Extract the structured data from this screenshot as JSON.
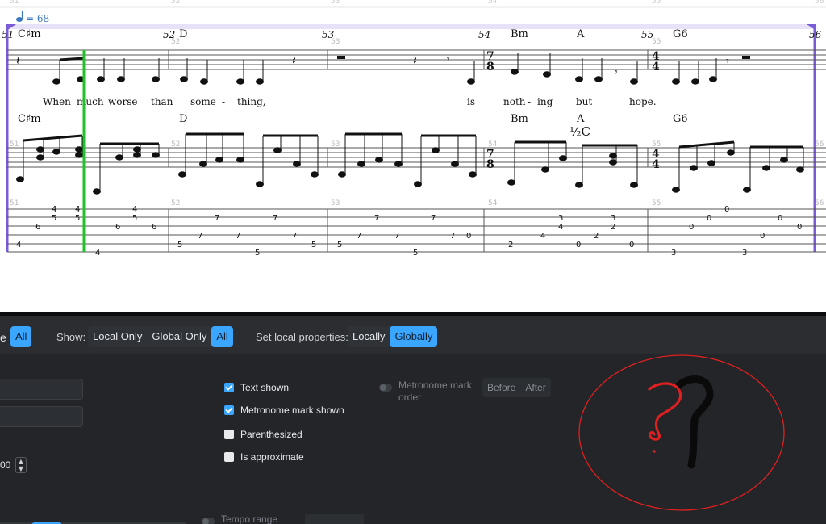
{
  "score": {
    "tempo": "= 68",
    "ruler_numbers": [
      "51",
      "52",
      "53",
      "54",
      "55",
      "56"
    ],
    "measure_numbers": [
      "51",
      "52",
      "53",
      "54",
      "55",
      "56"
    ],
    "small_numbers": [
      "52",
      "53",
      "55"
    ],
    "staff_measure_numbers": [
      "51",
      "52",
      "53",
      "54",
      "55",
      "56"
    ],
    "chords_top": [
      "C♯m",
      "D",
      "Bm",
      "A",
      "G6"
    ],
    "chords_mid": [
      "C♯m",
      "D",
      "Bm",
      "A",
      "G6"
    ],
    "half_capo": "½C",
    "lyrics": [
      "When",
      "much",
      "worse",
      "than__",
      "some",
      "-",
      "thing,",
      "is",
      "noth",
      "-",
      "ing",
      "but__",
      "hope.________"
    ],
    "time_sig_78": [
      "7",
      "8"
    ],
    "time_sig_44": [
      "4",
      "4"
    ],
    "tab_numbers": {
      "m51": [
        "4",
        "5",
        "6",
        "4",
        "5",
        "4",
        "4",
        "4",
        "5",
        "6"
      ],
      "m52": [
        "5",
        "7",
        "7",
        "7",
        "7",
        "5"
      ],
      "m53": [
        "5",
        "7",
        "7",
        "7",
        "7",
        "7",
        "0",
        "5"
      ],
      "m54": [
        "2",
        "4",
        "3",
        "4",
        "0",
        "0",
        "3",
        "2",
        "2",
        "0"
      ],
      "m55": [
        "0",
        "3",
        "0",
        "0",
        "3",
        "0"
      ],
      "m56": [
        "0"
      ]
    }
  },
  "toolbar": {
    "partial_label": "e",
    "all_label_1": "All",
    "show_label": "Show:",
    "show_options": [
      "Local Only",
      "Global Only",
      "All"
    ],
    "set_local_label": "Set local properties:",
    "set_local_options": [
      "Locally",
      "Globally"
    ]
  },
  "properties": {
    "text_shown": "Text shown",
    "metronome_mark_shown": "Metronome mark shown",
    "parenthesized": "Parenthesized",
    "is_approximate": "Is approximate",
    "metronome_mark_order": "Metronome mark order",
    "before_label": "Before",
    "after_label": "After",
    "tempo_range": "Tempo range (bpm)",
    "bpm_value": "00",
    "dots": [
      "•",
      "••"
    ]
  },
  "colors": {
    "accent": "#3aa6ff",
    "panel_bg": "#2b2d30",
    "subpanel_bg": "#232528",
    "cursor_green": "#22c02a",
    "loop_purple": "#7a5cd6",
    "annotation_red": "#e02020"
  }
}
